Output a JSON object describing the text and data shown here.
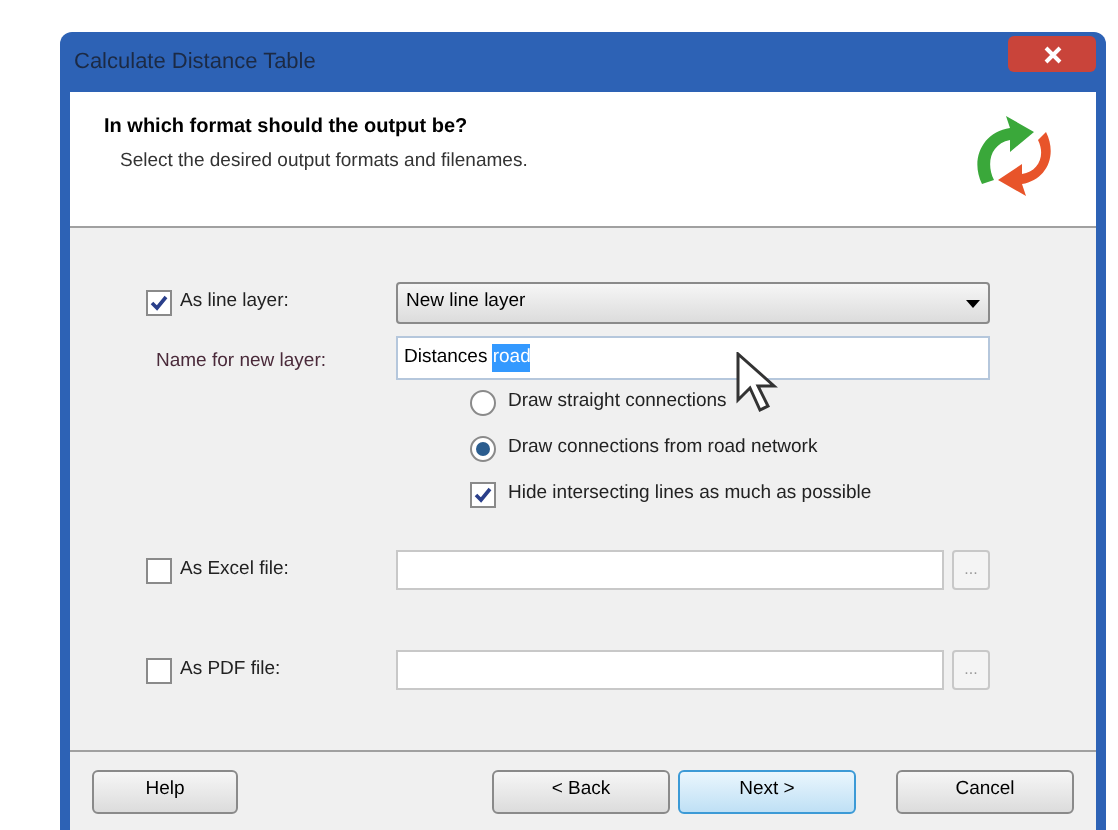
{
  "window": {
    "title": "Calculate Distance Table"
  },
  "header": {
    "title": "In which format should the output be?",
    "subtitle": "Select the desired output formats and filenames."
  },
  "line_layer": {
    "label": "As line layer:",
    "checked": true,
    "dropdown": "New line layer",
    "name_label": "Name for new layer:",
    "name_value": "Distances",
    "name_selected": "road",
    "options": [
      {
        "kind": "radio",
        "label": "Draw straight connections",
        "selected": false
      },
      {
        "kind": "radio",
        "label": "Draw connections from road network",
        "selected": true
      },
      {
        "kind": "checkbox",
        "label": "Hide intersecting lines as much as possible",
        "checked": true
      }
    ]
  },
  "files": [
    {
      "label": "As Excel file:",
      "checked": false,
      "browse": "..."
    },
    {
      "label": "As PDF file:",
      "checked": false,
      "browse": "..."
    }
  ],
  "buttons": [
    {
      "label": "Help",
      "default": false
    },
    {
      "label": "< Back",
      "default": false
    },
    {
      "label": "Next >",
      "default": true
    },
    {
      "label": "Cancel",
      "default": false
    }
  ]
}
